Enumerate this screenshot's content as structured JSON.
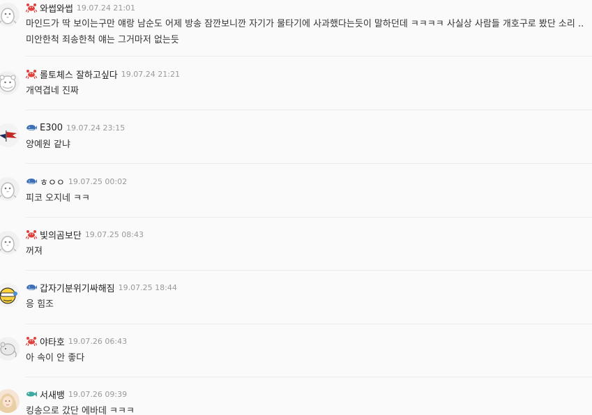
{
  "comments": [
    {
      "nickname": "와썹와썹",
      "date": "19.07.24 21:01",
      "badge": "crab-icon",
      "avatar": "penguin-avatar",
      "text": "마인드가 딱 보이는구만 얘랑 남순도 어제 방송 잠깐보니깐 자기가 물타기에 사과했다는듯이 말하던데 ㅋㅋㅋㅋ 사실상 사람들 개호구로 봤단 소리 .. 미안한척 죄송한척 얘는 그거마저 없는듯"
    },
    {
      "nickname": "롤토체스 잘하고싶다",
      "date": "19.07.24 21:21",
      "badge": "crab-icon",
      "avatar": "hamster-avatar",
      "text": "개역겹네 진짜"
    },
    {
      "nickname": "E300",
      "date": "19.07.24 23:15",
      "badge": "whale-icon",
      "avatar": "flag-avatar",
      "text": "양예원 같냐"
    },
    {
      "nickname": "ㅎㅇㅇ",
      "date": "19.07.25 00:02",
      "badge": "whale-icon",
      "avatar": "penguin-avatar",
      "text": "피코 오지네 ㅋㅋ"
    },
    {
      "nickname": "빛의곰보단",
      "date": "19.07.25 08:43",
      "badge": "crab-icon",
      "avatar": "penguin-avatar",
      "text": "꺼져"
    },
    {
      "nickname": "갑자기분위기싸해짐",
      "date": "19.07.25 18:44",
      "badge": "whale-icon",
      "avatar": "yellow-face-avatar",
      "text": "응 힘조"
    },
    {
      "nickname": "야타호",
      "date": "19.07.26 06:43",
      "badge": "crab-icon",
      "avatar": "mouse-avatar",
      "text": "아 속이 안 좋다"
    },
    {
      "nickname": "서새뱅",
      "date": "19.07.26 09:39",
      "badge": "fish-icon",
      "avatar": "photo-avatar",
      "text": "킹송으로 갔단 에바데 ㅋㅋㅋ"
    }
  ],
  "colors": {
    "crab": "#e0403c",
    "whale": "#3d6fb6",
    "fish": "#3fa9a0",
    "date": "#999999",
    "divider": "#ececec"
  }
}
